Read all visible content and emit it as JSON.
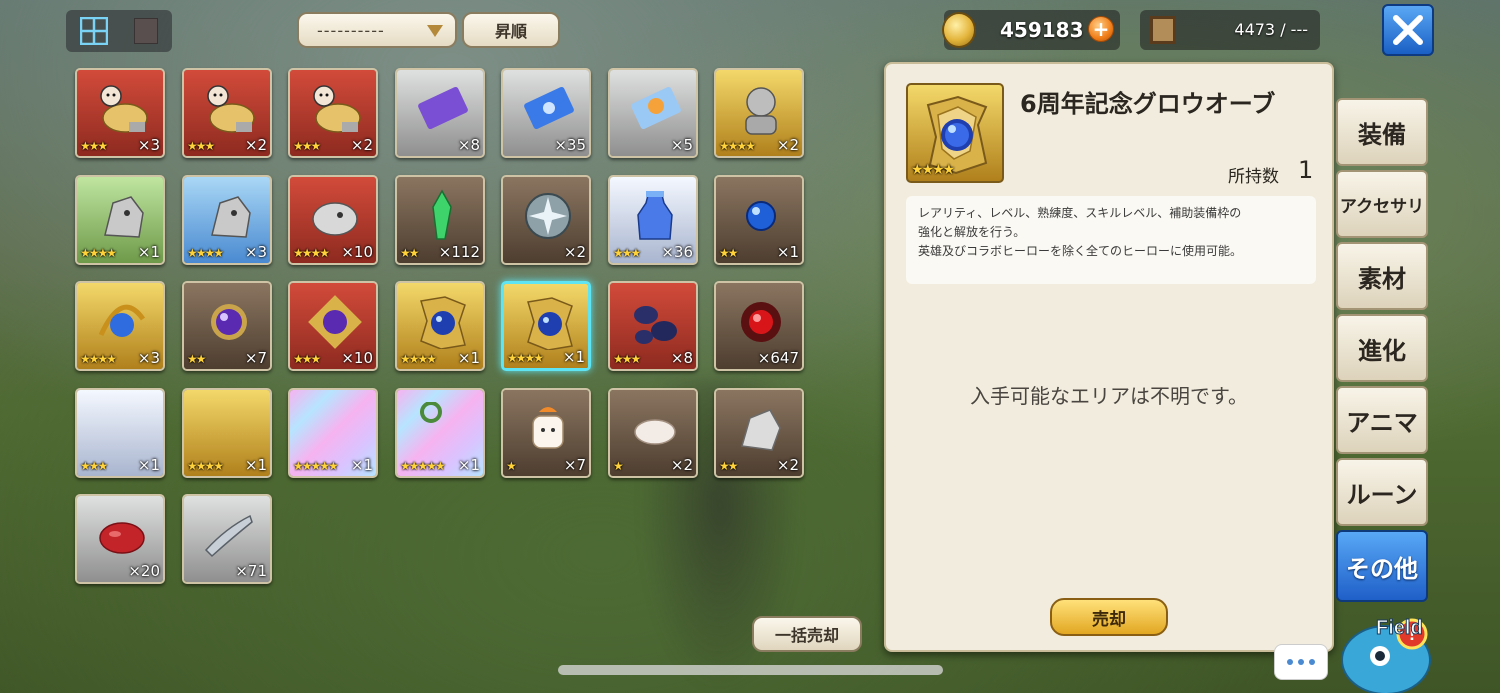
{
  "header": {
    "dropdown_value": "----------",
    "sort_label": "昇順",
    "gold": "459183",
    "storage": "4473 / ---"
  },
  "items": [
    {
      "rarity": "r-red",
      "art": "chicken",
      "stars": "★★★",
      "qty": "×3"
    },
    {
      "rarity": "r-red",
      "art": "chicken",
      "stars": "★★★",
      "qty": "×2"
    },
    {
      "rarity": "r-red",
      "art": "chicken",
      "stars": "★★★",
      "qty": "×2"
    },
    {
      "rarity": "r-silver",
      "art": "ticket-purple",
      "stars": "",
      "qty": "×8"
    },
    {
      "rarity": "r-silver",
      "art": "ticket-blue",
      "stars": "",
      "qty": "×35"
    },
    {
      "rarity": "r-silver",
      "art": "ticket-sun",
      "stars": "",
      "qty": "×5"
    },
    {
      "rarity": "r-gold",
      "art": "bust",
      "stars": "★★★★",
      "qty": "×2"
    },
    {
      "rarity": "r-green",
      "art": "dragon-gray",
      "stars": "★★★★",
      "qty": "×1"
    },
    {
      "rarity": "r-blue",
      "art": "dragon-gray",
      "stars": "★★★★",
      "qty": "×3"
    },
    {
      "rarity": "r-red",
      "art": "egg-head",
      "stars": "★★★★",
      "qty": "×10"
    },
    {
      "rarity": "r-brown",
      "art": "green-crystal",
      "stars": "★★",
      "qty": "×112"
    },
    {
      "rarity": "r-brown",
      "art": "silver-emblem",
      "stars": "",
      "qty": "×2"
    },
    {
      "rarity": "r-white",
      "art": "blue-vase",
      "stars": "★★★",
      "qty": "×36"
    },
    {
      "rarity": "r-brown",
      "art": "blue-orb",
      "stars": "★★",
      "qty": "×1"
    },
    {
      "rarity": "r-gold",
      "art": "gold-arc",
      "stars": "★★★★",
      "qty": "×3"
    },
    {
      "rarity": "r-brown",
      "art": "purple-orb",
      "stars": "★★",
      "qty": "×7"
    },
    {
      "rarity": "r-red",
      "art": "purple-orb-frame",
      "stars": "★★★",
      "qty": "×10"
    },
    {
      "rarity": "r-gold",
      "art": "glow-orb",
      "stars": "★★★★",
      "qty": "×1"
    },
    {
      "rarity": "r-gold",
      "art": "glow-orb",
      "stars": "★★★★",
      "qty": "×1",
      "selected": true
    },
    {
      "rarity": "r-red",
      "art": "dark-rocks",
      "stars": "★★★",
      "qty": "×8"
    },
    {
      "rarity": "r-brown",
      "art": "red-core",
      "stars": "",
      "qty": "×647"
    },
    {
      "rarity": "r-white",
      "art": "",
      "stars": "★★★",
      "qty": "×1"
    },
    {
      "rarity": "r-gold",
      "art": "",
      "stars": "★★★★",
      "qty": "×1"
    },
    {
      "rarity": "r-rainbow",
      "art": "",
      "stars": "★★★★★",
      "qty": "×1"
    },
    {
      "rarity": "r-rainbow",
      "art": "wreath",
      "stars": "★★★★★",
      "qty": "×1"
    },
    {
      "rarity": "r-brown",
      "art": "marshmallow",
      "stars": "★",
      "qty": "×7"
    },
    {
      "rarity": "r-brown",
      "art": "egg",
      "stars": "★",
      "qty": "×2"
    },
    {
      "rarity": "r-brown",
      "art": "stone",
      "stars": "★★",
      "qty": "×2"
    },
    {
      "rarity": "r-silver",
      "art": "meat",
      "stars": "",
      "qty": "×20"
    },
    {
      "rarity": "r-silver",
      "art": "fish",
      "stars": "",
      "qty": "×71"
    }
  ],
  "bulk_sell_label": "一括売却",
  "detail": {
    "stars": "★★★★",
    "title": "6周年記念グロウオーブ",
    "owned_label": "所持数",
    "owned_value": "1",
    "desc_line1": "レアリティ、レベル、熟練度、スキルレベル、補助装備枠の",
    "desc_line2": "強化と解放を行う。",
    "desc_line3": "英雄及びコラボヒーローを除く全てのヒーローに使用可能。",
    "area_text": "入手可能なエリアは不明です。",
    "sell_label": "売却"
  },
  "tabs": [
    {
      "label": "装備"
    },
    {
      "label": "アクセサリ"
    },
    {
      "label": "素材"
    },
    {
      "label": "進化"
    },
    {
      "label": "アニマ"
    },
    {
      "label": "ルーン"
    },
    {
      "label": "その他"
    }
  ],
  "field_label": "Field"
}
